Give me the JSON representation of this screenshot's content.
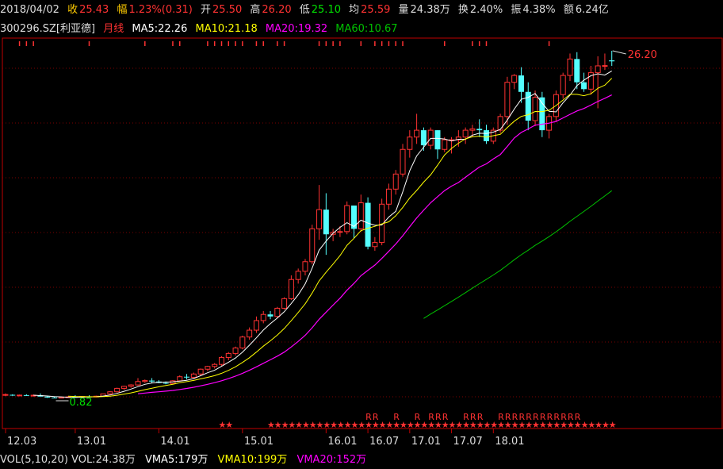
{
  "quote": {
    "date": "2018/04/02",
    "close_label": "收",
    "close": "25.43",
    "change_label": "幅",
    "change": "1.23%(0.31)",
    "open_label": "开",
    "open": "25.50",
    "high_label": "高",
    "high": "26.20",
    "low_label": "低",
    "low": "25.10",
    "avg_label": "均",
    "avg": "25.59",
    "vol_label": "量",
    "vol": "24.38万",
    "turn_label": "换",
    "turn": "2.40%",
    "amp_label": "振",
    "amp": "4.38%",
    "amt_label": "额",
    "amt": "6.24亿"
  },
  "stock": {
    "code": "300296.SZ",
    "name": "[利亚德]",
    "period": "月线"
  },
  "ma": {
    "ma5": "MA5:22.26",
    "ma10": "MA10:21.18",
    "ma20": "MA20:19.32",
    "ma60": "MA60:10.67"
  },
  "volume_bar": {
    "vol": "VOL(5,10,20)",
    "vol_value": "VOL:24.38万",
    "vma5": "VMA5:179万",
    "vma10": "VMA10:199万",
    "vma20": "VMA20:152万"
  },
  "colors": {
    "up": "#ff3232",
    "down": "#54ffff",
    "ma5": "#ffffff",
    "ma10": "#ffff00",
    "ma20": "#ff00ff",
    "ma60": "#00c000",
    "grid": "#7a0000",
    "axis": "#c00000"
  },
  "chart_data": {
    "type": "candlestick",
    "period": "monthly",
    "x_ticks": [
      "12.03",
      "13.01",
      "14.01",
      "15.01",
      "16.01",
      "16.07",
      "17.01",
      "17.07",
      "18.01"
    ],
    "annotations": {
      "max_price": "26.20",
      "min_price": "0.82"
    },
    "candles": [
      {
        "o": 1.05,
        "h": 1.18,
        "l": 0.98,
        "c": 1.1
      },
      {
        "o": 1.08,
        "h": 1.12,
        "l": 1.0,
        "c": 1.04
      },
      {
        "o": 1.04,
        "h": 1.1,
        "l": 0.98,
        "c": 1.06
      },
      {
        "o": 1.06,
        "h": 1.12,
        "l": 1.0,
        "c": 1.02
      },
      {
        "o": 1.02,
        "h": 1.1,
        "l": 0.95,
        "c": 1.05
      },
      {
        "o": 1.05,
        "h": 1.18,
        "l": 1.0,
        "c": 0.95
      },
      {
        "o": 0.95,
        "h": 1.0,
        "l": 0.85,
        "c": 0.88
      },
      {
        "o": 0.88,
        "h": 0.95,
        "l": 0.82,
        "c": 0.86
      },
      {
        "o": 0.86,
        "h": 0.95,
        "l": 0.82,
        "c": 0.9
      },
      {
        "o": 0.9,
        "h": 1.0,
        "l": 0.85,
        "c": 0.93
      },
      {
        "o": 0.93,
        "h": 1.05,
        "l": 0.9,
        "c": 0.9
      },
      {
        "o": 0.9,
        "h": 0.98,
        "l": 0.85,
        "c": 0.96
      },
      {
        "o": 0.96,
        "h": 1.05,
        "l": 0.92,
        "c": 0.94
      },
      {
        "o": 0.94,
        "h": 1.02,
        "l": 0.9,
        "c": 0.98
      },
      {
        "o": 0.98,
        "h": 1.1,
        "l": 0.95,
        "c": 1.15
      },
      {
        "o": 1.15,
        "h": 1.35,
        "l": 1.1,
        "c": 1.3
      },
      {
        "o": 1.3,
        "h": 1.6,
        "l": 1.25,
        "c": 1.55
      },
      {
        "o": 1.55,
        "h": 1.75,
        "l": 1.45,
        "c": 1.7
      },
      {
        "o": 1.7,
        "h": 1.85,
        "l": 1.6,
        "c": 1.8
      },
      {
        "o": 1.8,
        "h": 2.3,
        "l": 1.75,
        "c": 2.05
      },
      {
        "o": 2.05,
        "h": 2.2,
        "l": 1.95,
        "c": 2.12
      },
      {
        "o": 2.12,
        "h": 2.3,
        "l": 1.95,
        "c": 2.05
      },
      {
        "o": 2.05,
        "h": 2.15,
        "l": 1.92,
        "c": 1.95
      },
      {
        "o": 1.95,
        "h": 2.05,
        "l": 1.85,
        "c": 1.9
      },
      {
        "o": 1.9,
        "h": 2.15,
        "l": 1.85,
        "c": 2.1
      },
      {
        "o": 2.1,
        "h": 2.5,
        "l": 2.05,
        "c": 2.4
      },
      {
        "o": 2.4,
        "h": 2.6,
        "l": 2.2,
        "c": 2.35
      },
      {
        "o": 2.35,
        "h": 2.7,
        "l": 2.3,
        "c": 2.6
      },
      {
        "o": 2.6,
        "h": 3.0,
        "l": 2.5,
        "c": 2.95
      },
      {
        "o": 2.95,
        "h": 3.2,
        "l": 2.8,
        "c": 3.15
      },
      {
        "o": 3.15,
        "h": 3.4,
        "l": 3.0,
        "c": 3.3
      },
      {
        "o": 3.3,
        "h": 3.9,
        "l": 3.2,
        "c": 3.8
      },
      {
        "o": 3.8,
        "h": 4.2,
        "l": 3.6,
        "c": 4.1
      },
      {
        "o": 4.1,
        "h": 4.6,
        "l": 3.95,
        "c": 4.5
      },
      {
        "o": 4.5,
        "h": 5.4,
        "l": 4.4,
        "c": 5.3
      },
      {
        "o": 5.3,
        "h": 6.0,
        "l": 5.1,
        "c": 5.8
      },
      {
        "o": 5.8,
        "h": 6.8,
        "l": 5.6,
        "c": 6.5
      },
      {
        "o": 6.5,
        "h": 7.2,
        "l": 6.3,
        "c": 6.95
      },
      {
        "o": 6.95,
        "h": 7.2,
        "l": 6.6,
        "c": 6.8
      },
      {
        "o": 6.8,
        "h": 7.5,
        "l": 6.7,
        "c": 7.4
      },
      {
        "o": 7.4,
        "h": 8.2,
        "l": 7.3,
        "c": 8.1
      },
      {
        "o": 8.1,
        "h": 9.8,
        "l": 8.0,
        "c": 9.5
      },
      {
        "o": 9.5,
        "h": 10.3,
        "l": 9.2,
        "c": 10.1
      },
      {
        "o": 10.1,
        "h": 11.0,
        "l": 9.8,
        "c": 10.8
      },
      {
        "o": 10.8,
        "h": 13.5,
        "l": 10.6,
        "c": 13.2
      },
      {
        "o": 13.2,
        "h": 16.4,
        "l": 12.4,
        "c": 14.6
      },
      {
        "o": 14.6,
        "h": 15.8,
        "l": 11.3,
        "c": 12.8
      },
      {
        "o": 12.8,
        "h": 13.2,
        "l": 12.3,
        "c": 12.95
      },
      {
        "o": 12.95,
        "h": 13.4,
        "l": 12.6,
        "c": 13.0
      },
      {
        "o": 13.0,
        "h": 15.2,
        "l": 12.8,
        "c": 14.9
      },
      {
        "o": 14.9,
        "h": 14.9,
        "l": 12.5,
        "c": 13.2
      },
      {
        "o": 13.2,
        "h": 15.7,
        "l": 13.0,
        "c": 15.1
      },
      {
        "o": 15.1,
        "h": 15.5,
        "l": 11.7,
        "c": 11.9
      },
      {
        "o": 11.9,
        "h": 12.6,
        "l": 11.6,
        "c": 12.2
      },
      {
        "o": 12.2,
        "h": 15.4,
        "l": 12.0,
        "c": 15.0
      },
      {
        "o": 15.0,
        "h": 16.5,
        "l": 14.6,
        "c": 16.1
      },
      {
        "o": 16.1,
        "h": 17.5,
        "l": 15.7,
        "c": 17.2
      },
      {
        "o": 17.2,
        "h": 19.4,
        "l": 17.0,
        "c": 19.0
      },
      {
        "o": 19.0,
        "h": 20.4,
        "l": 18.4,
        "c": 19.9
      },
      {
        "o": 19.9,
        "h": 21.6,
        "l": 19.4,
        "c": 20.4
      },
      {
        "o": 20.4,
        "h": 20.6,
        "l": 18.9,
        "c": 19.3
      },
      {
        "o": 19.3,
        "h": 20.6,
        "l": 19.0,
        "c": 20.4
      },
      {
        "o": 20.4,
        "h": 20.4,
        "l": 18.3,
        "c": 19.0
      },
      {
        "o": 19.0,
        "h": 19.9,
        "l": 18.8,
        "c": 19.7
      },
      {
        "o": 19.7,
        "h": 19.9,
        "l": 18.7,
        "c": 19.7
      },
      {
        "o": 19.7,
        "h": 20.4,
        "l": 19.2,
        "c": 19.9
      },
      {
        "o": 19.9,
        "h": 20.6,
        "l": 19.4,
        "c": 20.4
      },
      {
        "o": 20.4,
        "h": 20.8,
        "l": 19.9,
        "c": 20.5
      },
      {
        "o": 20.5,
        "h": 21.2,
        "l": 19.9,
        "c": 20.4
      },
      {
        "o": 20.4,
        "h": 20.8,
        "l": 19.4,
        "c": 19.6
      },
      {
        "o": 19.6,
        "h": 20.6,
        "l": 19.4,
        "c": 20.4
      },
      {
        "o": 20.4,
        "h": 21.6,
        "l": 20.2,
        "c": 21.4
      },
      {
        "o": 21.4,
        "h": 24.3,
        "l": 20.8,
        "c": 23.9
      },
      {
        "o": 23.9,
        "h": 24.5,
        "l": 23.4,
        "c": 24.4
      },
      {
        "o": 24.4,
        "h": 25.0,
        "l": 22.4,
        "c": 23.2
      },
      {
        "o": 23.2,
        "h": 23.9,
        "l": 20.4,
        "c": 21.1
      },
      {
        "o": 21.1,
        "h": 23.3,
        "l": 20.7,
        "c": 22.8
      },
      {
        "o": 22.8,
        "h": 23.2,
        "l": 19.9,
        "c": 20.4
      },
      {
        "o": 20.4,
        "h": 21.6,
        "l": 19.8,
        "c": 21.4
      },
      {
        "o": 21.4,
        "h": 23.3,
        "l": 21.0,
        "c": 23.0
      },
      {
        "o": 23.0,
        "h": 24.6,
        "l": 22.7,
        "c": 24.4
      },
      {
        "o": 24.4,
        "h": 26.0,
        "l": 24.0,
        "c": 25.6
      },
      {
        "o": 25.6,
        "h": 26.1,
        "l": 23.4,
        "c": 23.9
      },
      {
        "o": 23.9,
        "h": 24.6,
        "l": 23.2,
        "c": 23.4
      },
      {
        "o": 23.4,
        "h": 25.1,
        "l": 23.0,
        "c": 24.6
      },
      {
        "o": 24.6,
        "h": 25.8,
        "l": 22.0,
        "c": 25.1
      },
      {
        "o": 25.1,
        "h": 26.0,
        "l": 24.8,
        "c": 25.12
      },
      {
        "o": 25.5,
        "h": 26.2,
        "l": 25.1,
        "c": 25.43
      }
    ]
  }
}
